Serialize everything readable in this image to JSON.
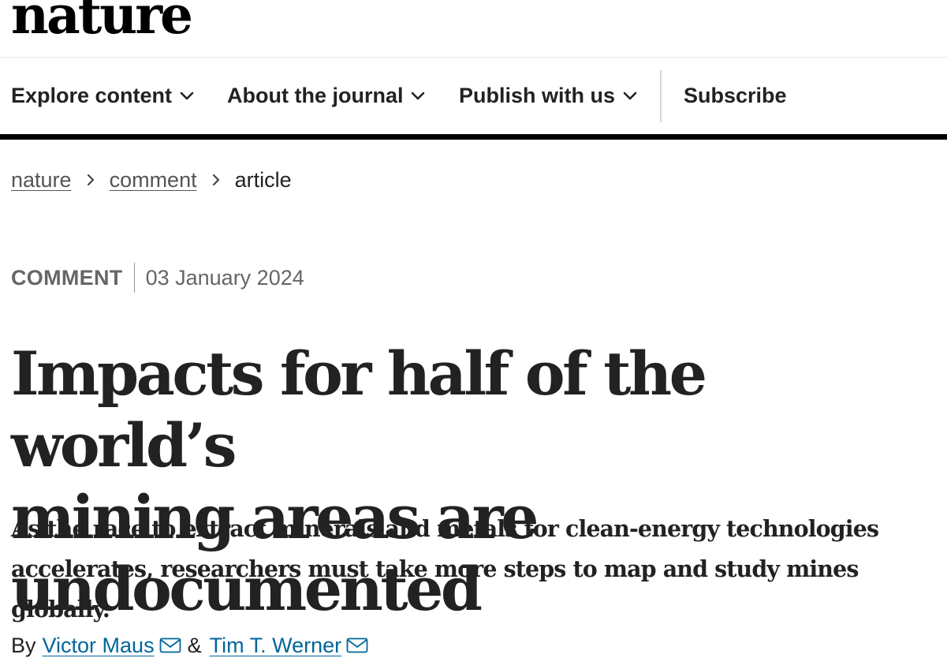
{
  "header": {
    "logo": "nature"
  },
  "nav": {
    "items": [
      {
        "label": "Explore content",
        "icon": "chevron-down-icon"
      },
      {
        "label": "About the journal",
        "icon": "chevron-down-icon"
      },
      {
        "label": "Publish with us",
        "icon": "chevron-down-icon"
      }
    ],
    "subscribe": "Subscribe"
  },
  "breadcrumb": {
    "items": [
      "nature",
      "comment"
    ],
    "current": "article"
  },
  "article": {
    "type": "COMMENT",
    "date": "03 January 2024",
    "title_line1": "Impacts for half of the world’s",
    "title_line2": "mining areas are undocumented",
    "standfirst_line1": "As the race to extract minerals and metals for clean-energy technologies",
    "standfirst_line2": "accelerates, researchers must take more steps to map and study mines globally.",
    "byline_prefix": "By",
    "authors": [
      "Victor Maus",
      "Tim T. Werner"
    ],
    "author_separator": "&"
  },
  "colors": {
    "text": "#222222",
    "muted": "#666666",
    "link": "#006699",
    "rule": "#000000"
  }
}
